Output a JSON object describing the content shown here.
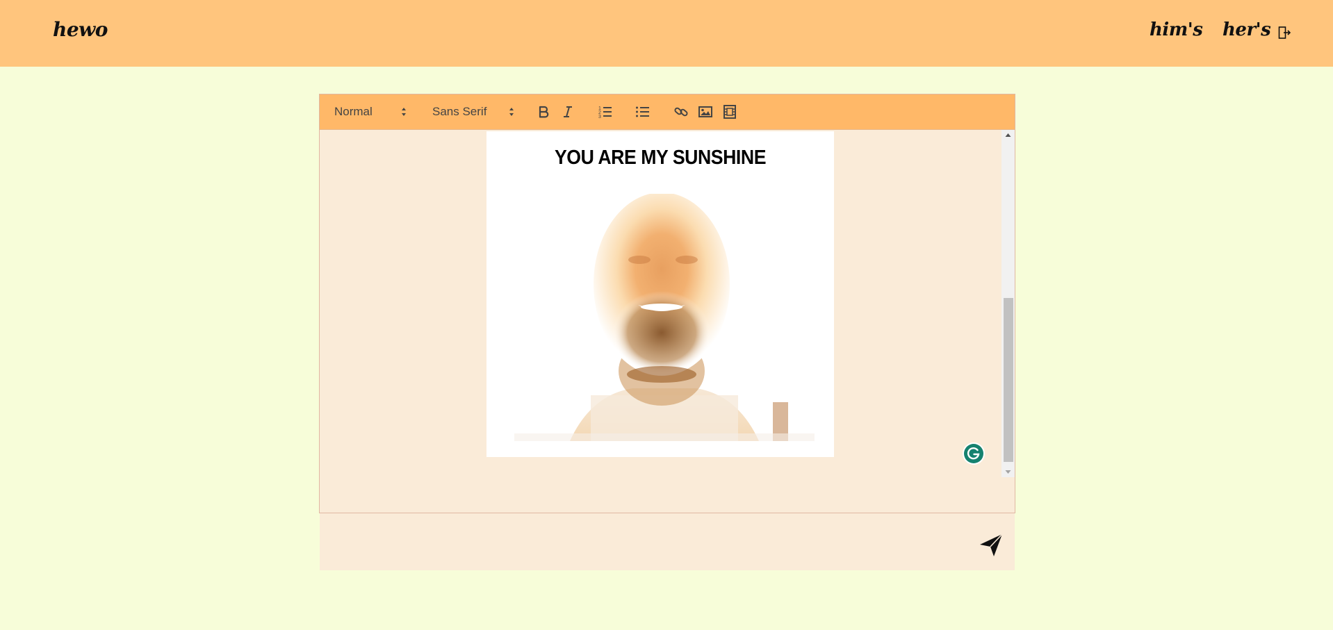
{
  "header": {
    "brand": "hewo",
    "nav": [
      {
        "label": "him's"
      },
      {
        "label": "her's"
      }
    ],
    "logout_icon": "logout-icon",
    "background_color": "#ffc57d"
  },
  "editor": {
    "toolbar": {
      "size_picker": "Normal",
      "font_picker": "Sans Serif",
      "buttons": [
        "bold-icon",
        "italic-icon",
        "ordered-list-icon",
        "bullet-list-icon",
        "link-icon",
        "image-icon",
        "video-icon"
      ],
      "background_color": "#ffb868"
    },
    "content": {
      "meme_caption": "YOU ARE MY SUNSHINE"
    },
    "background_color": "#faebd8"
  },
  "send": {
    "icon": "send-icon"
  },
  "page_background": "#f7fdd9"
}
